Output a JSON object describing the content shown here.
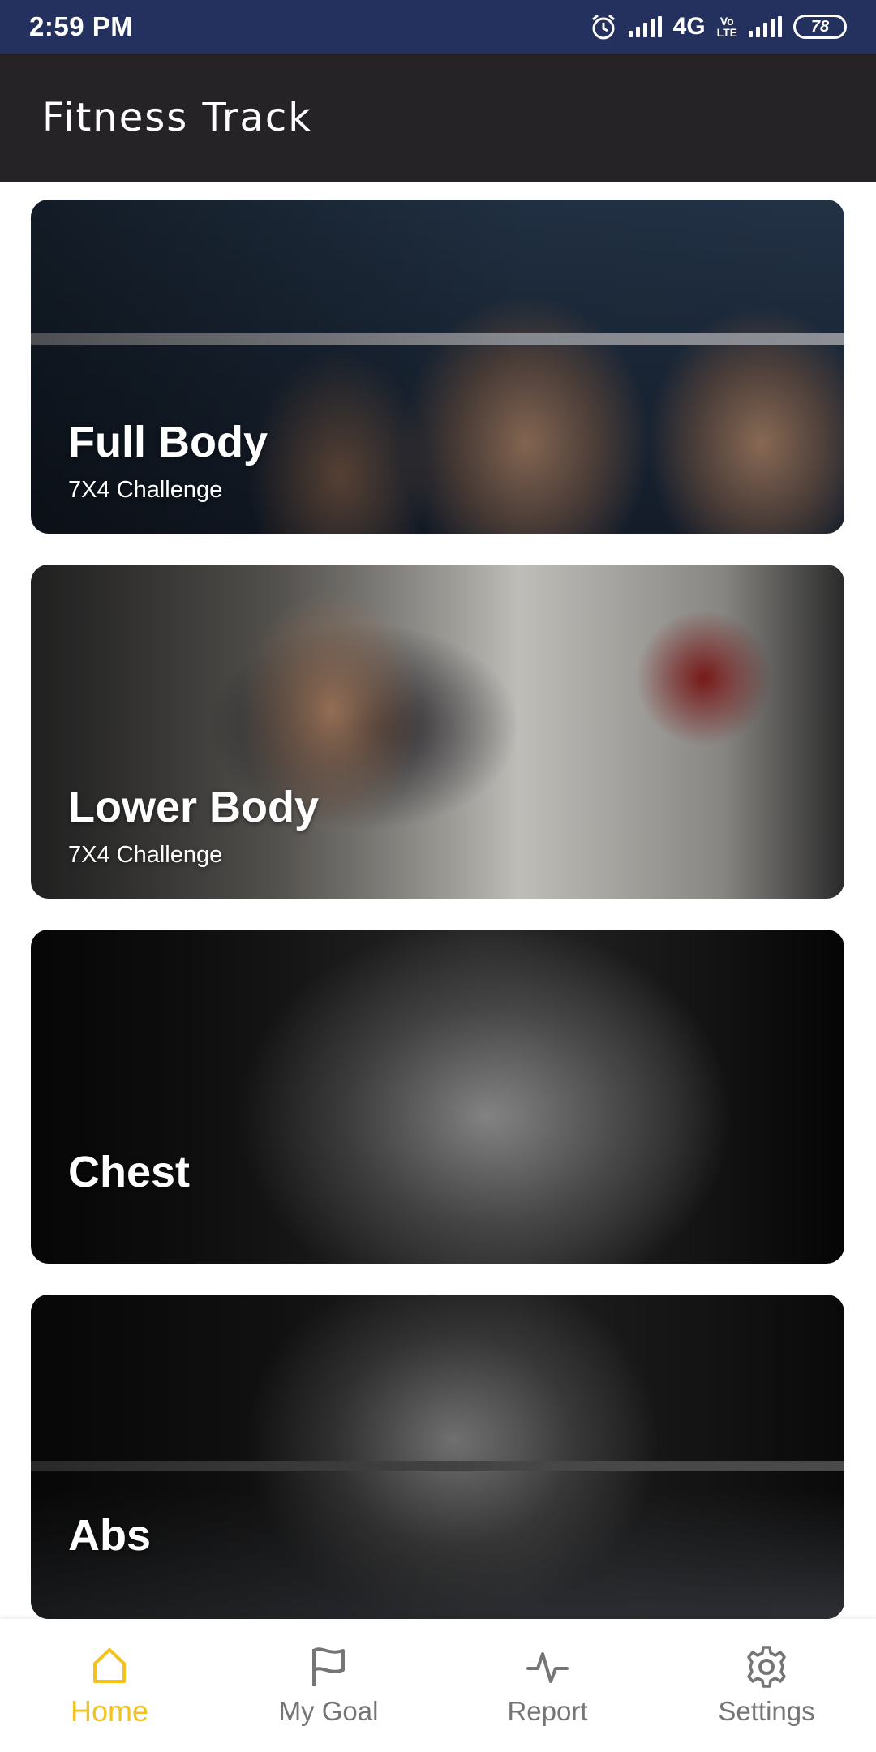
{
  "status_bar": {
    "time": "2:59 PM",
    "network": "4G",
    "volte_top": "Vo",
    "volte_bottom": "LTE",
    "battery": "78"
  },
  "app_bar": {
    "title": "Fitness Track"
  },
  "cards": [
    {
      "title": "Full Body",
      "subtitle": "7X4 Challenge"
    },
    {
      "title": "Lower Body",
      "subtitle": "7X4 Challenge"
    },
    {
      "title": "Chest",
      "subtitle": ""
    },
    {
      "title": "Abs",
      "subtitle": ""
    }
  ],
  "bottom_nav": {
    "items": [
      {
        "label": "Home",
        "icon": "home-icon",
        "active": true
      },
      {
        "label": "My Goal",
        "icon": "flag-icon",
        "active": false
      },
      {
        "label": "Report",
        "icon": "activity-icon",
        "active": false
      },
      {
        "label": "Settings",
        "icon": "gear-icon",
        "active": false
      }
    ],
    "active_color": "#f3c21d",
    "inactive_color": "#757575"
  },
  "colors": {
    "status_bar": "#24305e",
    "app_bar": "#252325"
  }
}
